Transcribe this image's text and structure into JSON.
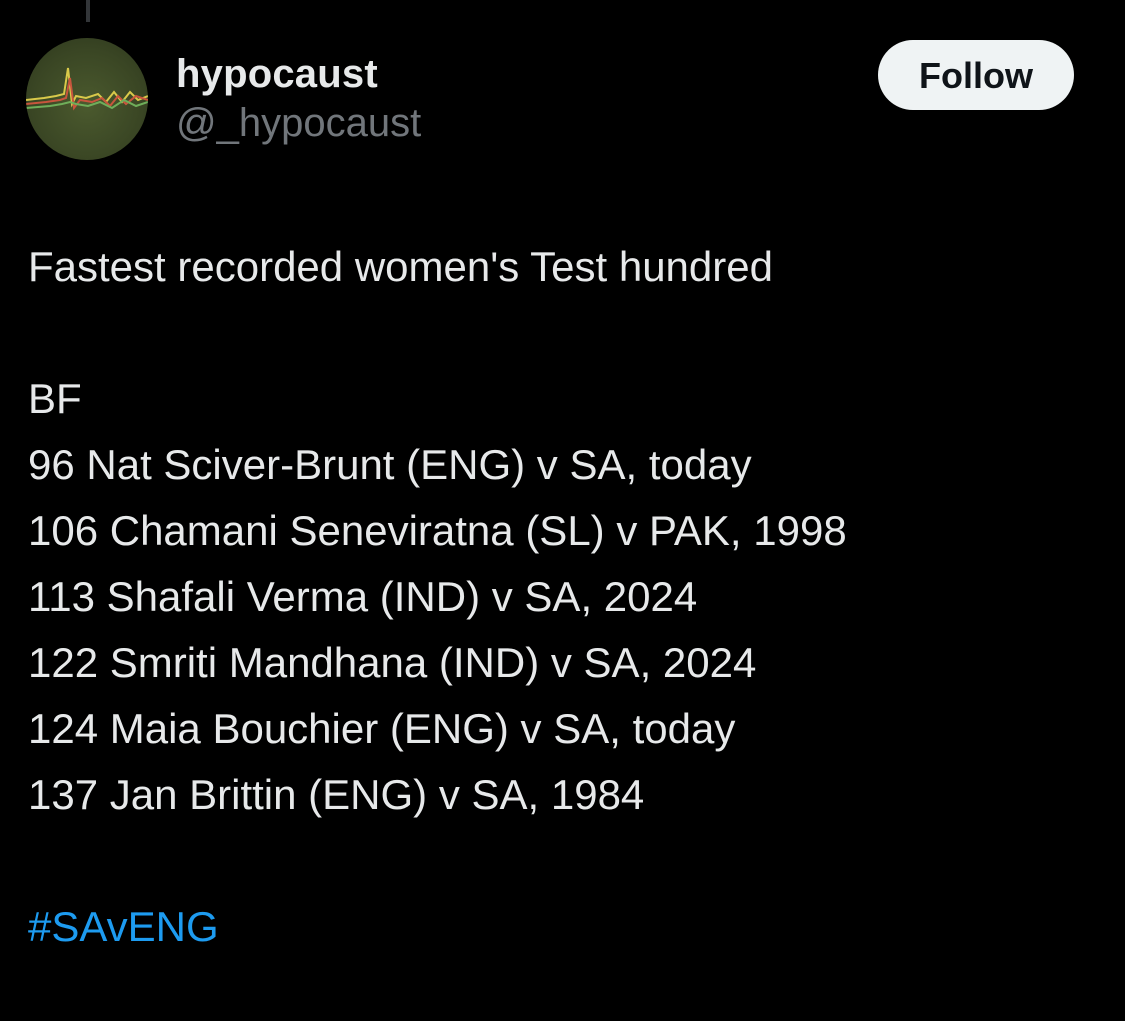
{
  "author": {
    "display_name": "hypocaust",
    "handle": "@_hypocaust",
    "avatar_icon": "heart-rate-graph-avatar"
  },
  "follow_label": "Follow",
  "tweet": {
    "headline": "Fastest recorded women's Test hundred",
    "list_header": "BF",
    "entries": [
      "96 Nat Sciver-Brunt (ENG) v SA, today",
      "106 Chamani Seneviratna (SL) v PAK, 1998",
      "113 Shafali Verma (IND) v SA, 2024",
      "122 Smriti Mandhana (IND) v SA, 2024",
      "124 Maia Bouchier (ENG) v SA, today",
      "137 Jan Brittin (ENG) v SA, 1984"
    ],
    "hashtag": "#SAvENG"
  },
  "colors": {
    "background": "#000000",
    "text": "#e7e9ea",
    "secondary_text": "#71767b",
    "link": "#1d9bf0",
    "follow_button_bg": "#eff3f4"
  }
}
